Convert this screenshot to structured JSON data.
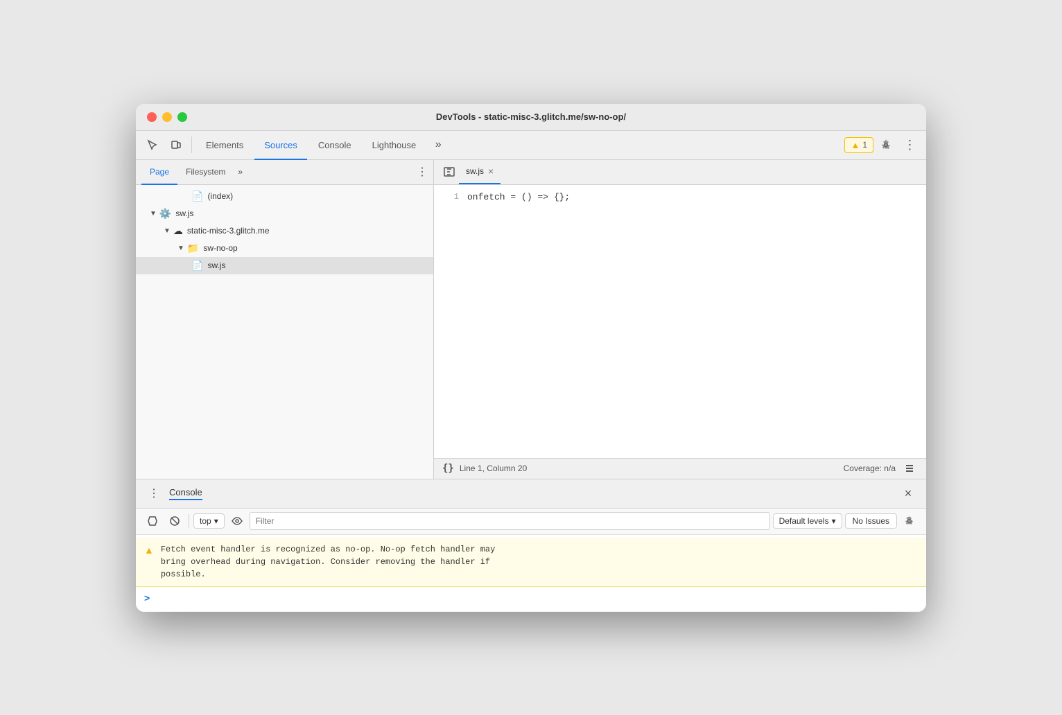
{
  "window": {
    "title": "DevTools - static-misc-3.glitch.me/sw-no-op/"
  },
  "toolbar": {
    "tabs": [
      {
        "id": "elements",
        "label": "Elements",
        "active": false
      },
      {
        "id": "sources",
        "label": "Sources",
        "active": true
      },
      {
        "id": "console",
        "label": "Console",
        "active": false
      },
      {
        "id": "lighthouse",
        "label": "Lighthouse",
        "active": false
      }
    ],
    "more_tabs_label": "»",
    "warning_count": "1",
    "warning_label": "▲ 1"
  },
  "left_panel": {
    "tabs": [
      {
        "id": "page",
        "label": "Page",
        "active": true
      },
      {
        "id": "filesystem",
        "label": "Filesystem",
        "active": false
      }
    ],
    "more_label": "»",
    "file_tree": [
      {
        "id": "index",
        "indent": 80,
        "icon": "📄",
        "label": "(index)",
        "selected": false
      },
      {
        "id": "sw-js-root",
        "indent": 20,
        "arrow": "▼",
        "icon": "⚙️",
        "label": "sw.js",
        "selected": false
      },
      {
        "id": "static-misc",
        "indent": 40,
        "arrow": "▼",
        "icon": "☁",
        "label": "static-misc-3.glitch.me",
        "selected": false
      },
      {
        "id": "sw-no-op",
        "indent": 60,
        "arrow": "▼",
        "icon": "📁",
        "label": "sw-no-op",
        "selected": false,
        "folder_color": "#4fc3f7"
      },
      {
        "id": "sw-js",
        "indent": 80,
        "icon": "📄",
        "label": "sw.js",
        "selected": true,
        "file_color": "#f0b000"
      }
    ]
  },
  "editor": {
    "tab_filename": "sw.js",
    "code_lines": [
      {
        "number": "1",
        "code": "onfetch = () => {};"
      }
    ]
  },
  "status_bar": {
    "format_label": "{}",
    "position": "Line 1, Column 20",
    "coverage": "Coverage: n/a"
  },
  "console_panel": {
    "title": "Console",
    "close_label": "×"
  },
  "console_toolbar": {
    "context": "top",
    "filter_placeholder": "Filter",
    "levels_label": "Default levels",
    "issues_label": "No Issues"
  },
  "warning_message": {
    "text": "Fetch event handler is recognized as no-op. No-op fetch handler may\nbring overhead during navigation. Consider removing the handler if\npossible."
  },
  "console_prompt": {
    "chevron": ">"
  }
}
